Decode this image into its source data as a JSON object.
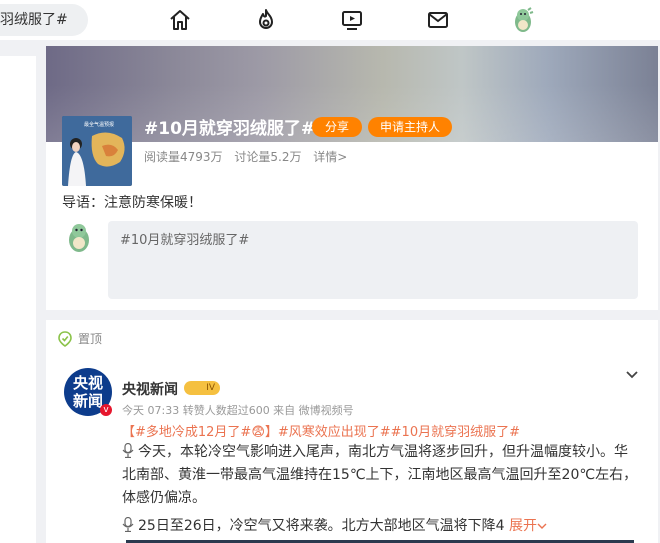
{
  "search": {
    "text": "羽绒服了#"
  },
  "nav": {
    "items": [
      "home-icon",
      "hot-icon",
      "video-icon",
      "mail-icon",
      "avatar"
    ]
  },
  "topic": {
    "title": "#10月就穿羽绒服了#",
    "share_label": "分享",
    "host_label": "申请主持人",
    "reads": "阅读量4793万",
    "discussions": "讨论量5.2万",
    "details": "详情>",
    "cover_caption": "最全气温预报",
    "guide": "导语：注意防寒保暖！",
    "compose_placeholder": "#10月就穿羽绒服了#"
  },
  "post": {
    "pinned_label": "置顶",
    "logo_line1": "央视",
    "logo_line2": "新闻",
    "verified_mark": "v",
    "author": "央视新闻",
    "level": "IV",
    "meta": "今天 07:33 转赞人数超过600 来自 微博视频号",
    "tags": "【#多地冷成12月了#😨】#风寒效应出现了##10月就穿羽绒服了#",
    "body1": "今天，本轮冷空气影响进入尾声，南北方气温将逐步回升，但升温幅度较小。华北南部、黄淮一带最高气温维持在15℃上下，江南地区最高气温回升至20℃左右，体感仍偏凉。",
    "body2": "25日至26日，冷空气又将来袭。北方大部地区气温将下降4",
    "expand_label": "展开"
  },
  "colors": {
    "accent": "#ff8200",
    "link": "#eb7350",
    "brand_blue": "#0d3c8c"
  }
}
